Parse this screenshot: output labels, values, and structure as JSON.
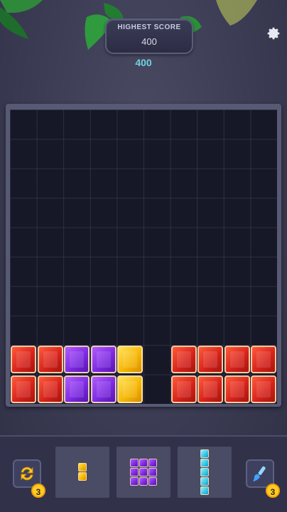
{
  "header": {
    "highest_score_label": "HIGHEST SCORE",
    "highest_score_value": "400",
    "current_score": "400"
  },
  "colors": {
    "red": "#d4201a",
    "purple": "#7a27e0",
    "yellow": "#f5b400",
    "cyan": "#38c4e6",
    "empty": "#161827"
  },
  "board": {
    "columns": 10,
    "rows": 10,
    "filled": [
      {
        "row": 8,
        "col": 0,
        "color": "red"
      },
      {
        "row": 8,
        "col": 1,
        "color": "red"
      },
      {
        "row": 8,
        "col": 2,
        "color": "purple"
      },
      {
        "row": 8,
        "col": 3,
        "color": "purple"
      },
      {
        "row": 8,
        "col": 4,
        "color": "yellow"
      },
      {
        "row": 8,
        "col": 6,
        "color": "red"
      },
      {
        "row": 8,
        "col": 7,
        "color": "red"
      },
      {
        "row": 8,
        "col": 8,
        "color": "red"
      },
      {
        "row": 8,
        "col": 9,
        "color": "red"
      },
      {
        "row": 9,
        "col": 0,
        "color": "red"
      },
      {
        "row": 9,
        "col": 1,
        "color": "red"
      },
      {
        "row": 9,
        "col": 2,
        "color": "purple"
      },
      {
        "row": 9,
        "col": 3,
        "color": "purple"
      },
      {
        "row": 9,
        "col": 4,
        "color": "yellow"
      },
      {
        "row": 9,
        "col": 6,
        "color": "red"
      },
      {
        "row": 9,
        "col": 7,
        "color": "red"
      },
      {
        "row": 9,
        "col": 8,
        "color": "red"
      },
      {
        "row": 9,
        "col": 9,
        "color": "red"
      }
    ]
  },
  "tray": {
    "refresh_tool": {
      "icon": "refresh-icon",
      "count": "3"
    },
    "clear_tool": {
      "icon": "brush-icon",
      "count": "3"
    },
    "pieces": [
      {
        "name": "vertical-2-yellow",
        "color": "yellow",
        "rows": 2,
        "cols": 1
      },
      {
        "name": "square-3x3-purple",
        "color": "purple",
        "rows": 3,
        "cols": 3
      },
      {
        "name": "vertical-5-cyan",
        "color": "cyan",
        "rows": 5,
        "cols": 1
      }
    ]
  },
  "icons": {
    "settings": "gear-icon"
  }
}
